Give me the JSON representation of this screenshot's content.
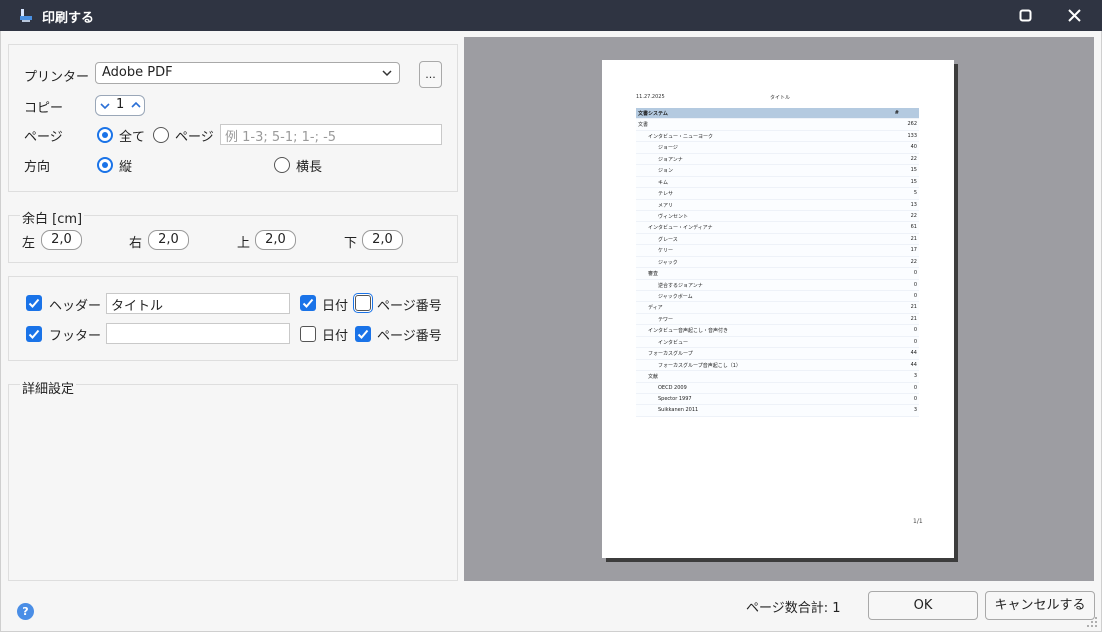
{
  "window": {
    "title": "印刷する"
  },
  "printer": {
    "label": "プリンター",
    "selected": "Adobe PDF",
    "browse_label": "..."
  },
  "copies": {
    "label": "コピー",
    "value": "1"
  },
  "pages": {
    "label": "ページ",
    "all_label": "全て",
    "range_label": "ページ",
    "range_placeholder": "例 1-3; 5-1; 1-; -5",
    "selected": "all"
  },
  "orientation": {
    "label": "方向",
    "portrait_label": "縦",
    "landscape_label": "横長",
    "selected": "portrait"
  },
  "margins": {
    "title": "余白 [cm]",
    "left_label": "左",
    "left": "2,0",
    "right_label": "右",
    "right": "2,0",
    "top_label": "上",
    "top": "2,0",
    "bottom_label": "下",
    "bottom": "2,0"
  },
  "header": {
    "checked": true,
    "label": "ヘッダー",
    "text": "タイトル",
    "date_checked": true,
    "date_label": "日付",
    "page_number_checked": false,
    "page_number_label": "ページ番号"
  },
  "footer": {
    "checked": true,
    "label": "フッター",
    "text": "",
    "date_checked": false,
    "date_label": "日付",
    "page_number_checked": true,
    "page_number_label": "ページ番号"
  },
  "advanced": {
    "title": "詳細設定"
  },
  "preview": {
    "date": "11.27.2025",
    "title": "タイトル",
    "column_header": "文書システム",
    "count_header": "#",
    "rows": [
      {
        "name": "文書",
        "value": "262",
        "level": 0
      },
      {
        "name": "インタビュー・ニューヨーク",
        "value": "133",
        "level": 1
      },
      {
        "name": "ジョージ",
        "value": "40",
        "level": 2
      },
      {
        "name": "ジョアンナ",
        "value": "22",
        "level": 2
      },
      {
        "name": "ジョン",
        "value": "15",
        "level": 2
      },
      {
        "name": "キム",
        "value": "15",
        "level": 2
      },
      {
        "name": "テレサ",
        "value": "5",
        "level": 2
      },
      {
        "name": "メアリ",
        "value": "13",
        "level": 2
      },
      {
        "name": "ヴィンセント",
        "value": "22",
        "level": 2
      },
      {
        "name": "インタビュー・インディアナ",
        "value": "61",
        "level": 1
      },
      {
        "name": "グレース",
        "value": "21",
        "level": 2
      },
      {
        "name": "ケリー",
        "value": "17",
        "level": 2
      },
      {
        "name": "ジャック",
        "value": "22",
        "level": 2
      },
      {
        "name": "審査",
        "value": "0",
        "level": 1
      },
      {
        "name": "逆合するジョアンナ",
        "value": "0",
        "level": 2
      },
      {
        "name": "ジャックボーム",
        "value": "0",
        "level": 2
      },
      {
        "name": "ディア",
        "value": "21",
        "level": 1
      },
      {
        "name": "テワー",
        "value": "21",
        "level": 2
      },
      {
        "name": "インタビュー音声起こし・音声付き",
        "value": "0",
        "level": 1
      },
      {
        "name": "インタビュー",
        "value": "0",
        "level": 2
      },
      {
        "name": "フォーカスグループ",
        "value": "44",
        "level": 1
      },
      {
        "name": "フォーカスグループ音声起こし（1）",
        "value": "44",
        "level": 2
      },
      {
        "name": "文献",
        "value": "3",
        "level": 1
      },
      {
        "name": "OECD 2009",
        "value": "0",
        "level": 2
      },
      {
        "name": "Spector 1997",
        "value": "0",
        "level": 2
      },
      {
        "name": "Suikkanen 2011",
        "value": "3",
        "level": 2
      }
    ],
    "page_footer": "1/1"
  },
  "footer_bar": {
    "help": "?",
    "page_total": "ページ数合計: 1",
    "ok_label": "OK",
    "cancel_label": "キャンセルする"
  },
  "colors": {
    "accent": "#1a73e8",
    "titlebar": "#2f3442",
    "preview_bg": "#9d9da2",
    "table_header": "#b4cae0"
  }
}
